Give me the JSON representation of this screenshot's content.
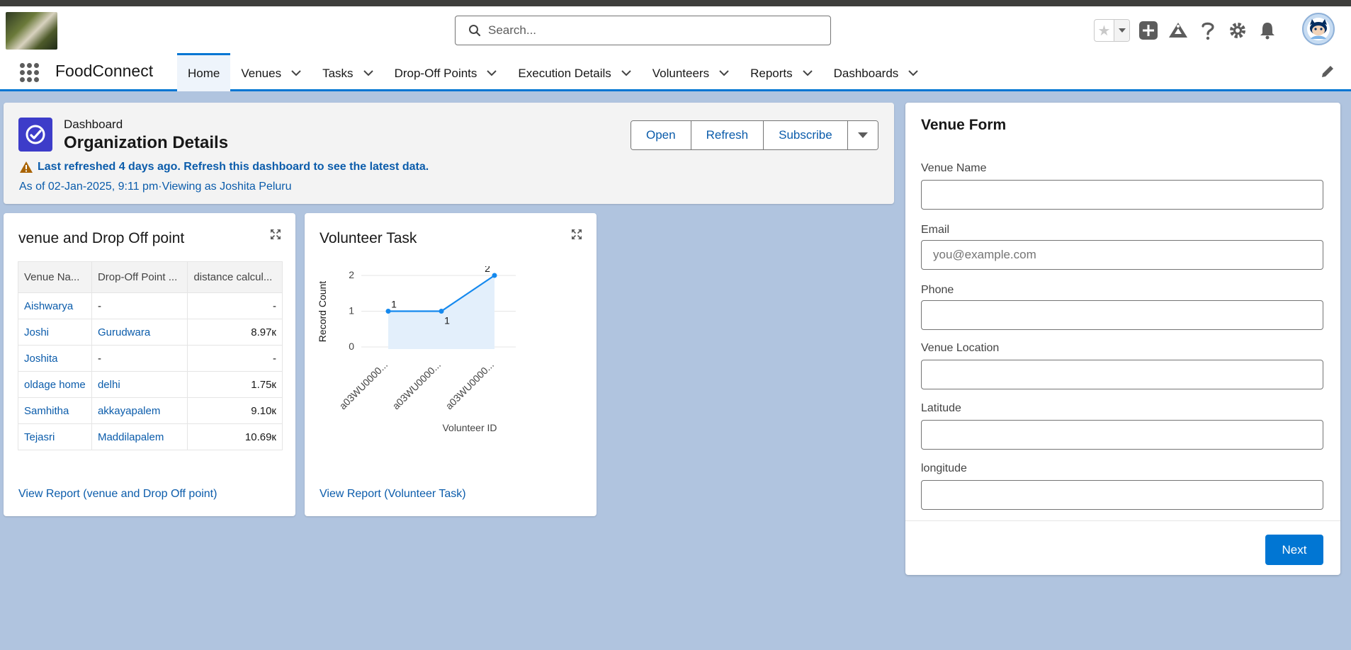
{
  "header": {
    "search_placeholder": "Search...",
    "avatar_label": "user-avatar"
  },
  "nav": {
    "app_name": "FoodConnect",
    "tabs": [
      {
        "label": "Home",
        "active": true
      },
      {
        "label": "Venues"
      },
      {
        "label": "Tasks"
      },
      {
        "label": "Drop-Off Points"
      },
      {
        "label": "Execution Details"
      },
      {
        "label": "Volunteers"
      },
      {
        "label": "Reports"
      },
      {
        "label": "Dashboards"
      }
    ]
  },
  "dashboard": {
    "type_label": "Dashboard",
    "title": "Organization Details",
    "warning": "Last refreshed 4 days ago. Refresh this dashboard to see the latest data.",
    "as_of": "As of 02-Jan-2025, 9:11 pm·Viewing as Joshita Peluru",
    "buttons": {
      "open": "Open",
      "refresh": "Refresh",
      "subscribe": "Subscribe"
    }
  },
  "venue_card": {
    "title": "venue and Drop Off point",
    "columns": [
      "Venue Na...",
      "Drop-Off Point ...",
      "distance calcul..."
    ],
    "rows": [
      {
        "venue": "Aishwarya",
        "dropoff": "-",
        "distance": "-"
      },
      {
        "venue": "Joshi",
        "dropoff": "Gurudwara",
        "distance": "8.97к"
      },
      {
        "venue": "Joshita",
        "dropoff": "-",
        "distance": "-"
      },
      {
        "venue": "oldage home",
        "dropoff": "delhi",
        "distance": "1.75к"
      },
      {
        "venue": "Samhitha",
        "dropoff": "akkayapalem",
        "distance": "9.10к"
      },
      {
        "venue": "Tejasri",
        "dropoff": "Maddilapalem",
        "distance": "10.69к"
      }
    ],
    "link": "View Report (venue and Drop Off point)"
  },
  "volunteer_card": {
    "title": "Volunteer Task",
    "link": "View Report (Volunteer Task)"
  },
  "chart_data": {
    "type": "line",
    "title": "",
    "xlabel": "Volunteer ID",
    "ylabel": "Record Count",
    "categories": [
      "a03WU0000...",
      "a03WU0000...",
      "a03WU0000..."
    ],
    "values": [
      1,
      1,
      2
    ],
    "data_labels": [
      "1",
      "1",
      "2"
    ],
    "yticks": [
      "0",
      "1",
      "2"
    ],
    "ylim": [
      0,
      2
    ],
    "grid": true,
    "area_fill": true,
    "color": "#1589ee"
  },
  "form": {
    "title": "Venue Form",
    "fields": {
      "venue_name": {
        "label": "Venue Name",
        "placeholder": "",
        "value": ""
      },
      "email": {
        "label": "Email",
        "placeholder": "you@example.com",
        "value": ""
      },
      "phone": {
        "label": "Phone",
        "placeholder": "",
        "value": ""
      },
      "venue_location": {
        "label": "Venue Location",
        "placeholder": "",
        "value": ""
      },
      "latitude": {
        "label": "Latitude",
        "placeholder": "",
        "value": ""
      },
      "longitude": {
        "label": "longitude",
        "placeholder": "",
        "value": ""
      }
    },
    "next_label": "Next"
  },
  "colors": {
    "brand": "#0176d3",
    "link": "#0b5cab",
    "dashboard_icon": "#3d3cc9",
    "warning": "#c23934",
    "background": "#b0c4df"
  }
}
